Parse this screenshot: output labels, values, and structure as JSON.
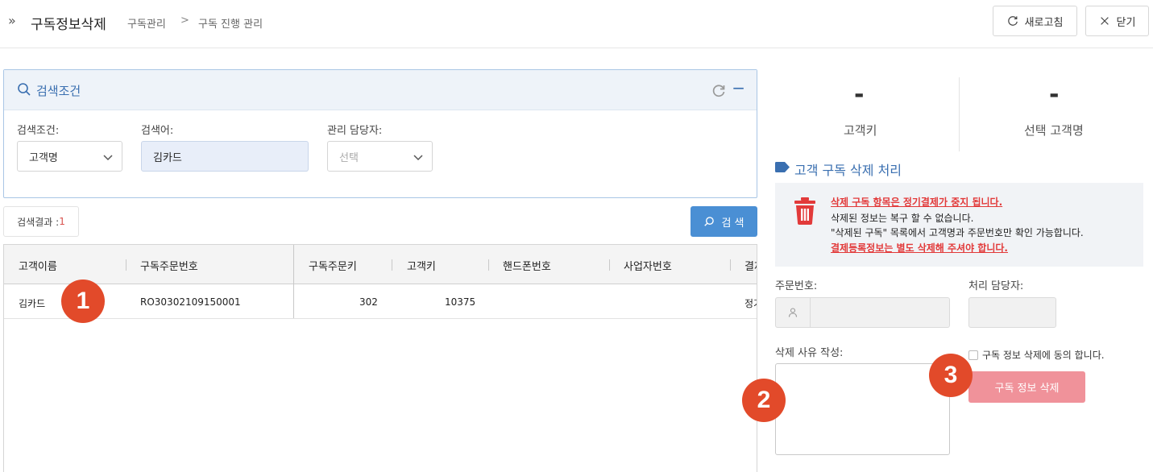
{
  "header": {
    "title": "구독정보삭제",
    "breadcrumb": [
      "구독관리",
      "구독 진행 관리"
    ],
    "refresh_label": "새로고침",
    "close_label": "닫기"
  },
  "search": {
    "title": "검색조건",
    "condition_label": "검색조건:",
    "condition_value": "고객명",
    "keyword_label": "검색어:",
    "keyword_value": "김카드",
    "manager_label": "관리 담당자:",
    "manager_placeholder": "선택",
    "result_label": "검색결과 : ",
    "result_count": "1",
    "search_button": "검 색"
  },
  "grid": {
    "columns": [
      "고객이름",
      "구독주문번호",
      "구독주문키",
      "고객키",
      "핸드폰번호",
      "사업자번호",
      "결제"
    ],
    "rows": [
      {
        "name": "김카드",
        "order_no": "RO30302109150001",
        "order_key": "302",
        "customer_key": "10375",
        "phone": "",
        "biz_no": "",
        "pay": "정기"
      }
    ]
  },
  "stats": [
    {
      "value": "-",
      "label": "고객키"
    },
    {
      "value": "-",
      "label": "선택 고객명"
    }
  ],
  "delete_section": {
    "title": "고객 구독 삭제 처리",
    "notice": [
      "삭제 구독 항목은 정기결제가 중지 됩니다.",
      "삭제된 정보는 복구 할 수 없습니다.",
      "\"삭제된 구독\" 목록에서 고객명과 주문번호만 확인 가능합니다.",
      "결제등록정보는 별도 삭제해 주셔야 합니다."
    ],
    "order_no_label": "주문번호:",
    "manager_label": "처리 담당자:",
    "reason_label": "삭제 사유 작성:",
    "agree_label": "구독 정보 삭제에 동의 합니다.",
    "delete_button": "구독 정보 삭제"
  },
  "badges": [
    "1",
    "2",
    "3"
  ],
  "colors": {
    "accent": "#4a8fd4",
    "title_blue": "#3a6fb0",
    "badge": "#e24a2a",
    "warning": "#e23a3a",
    "delete_button": "#f0929a"
  }
}
